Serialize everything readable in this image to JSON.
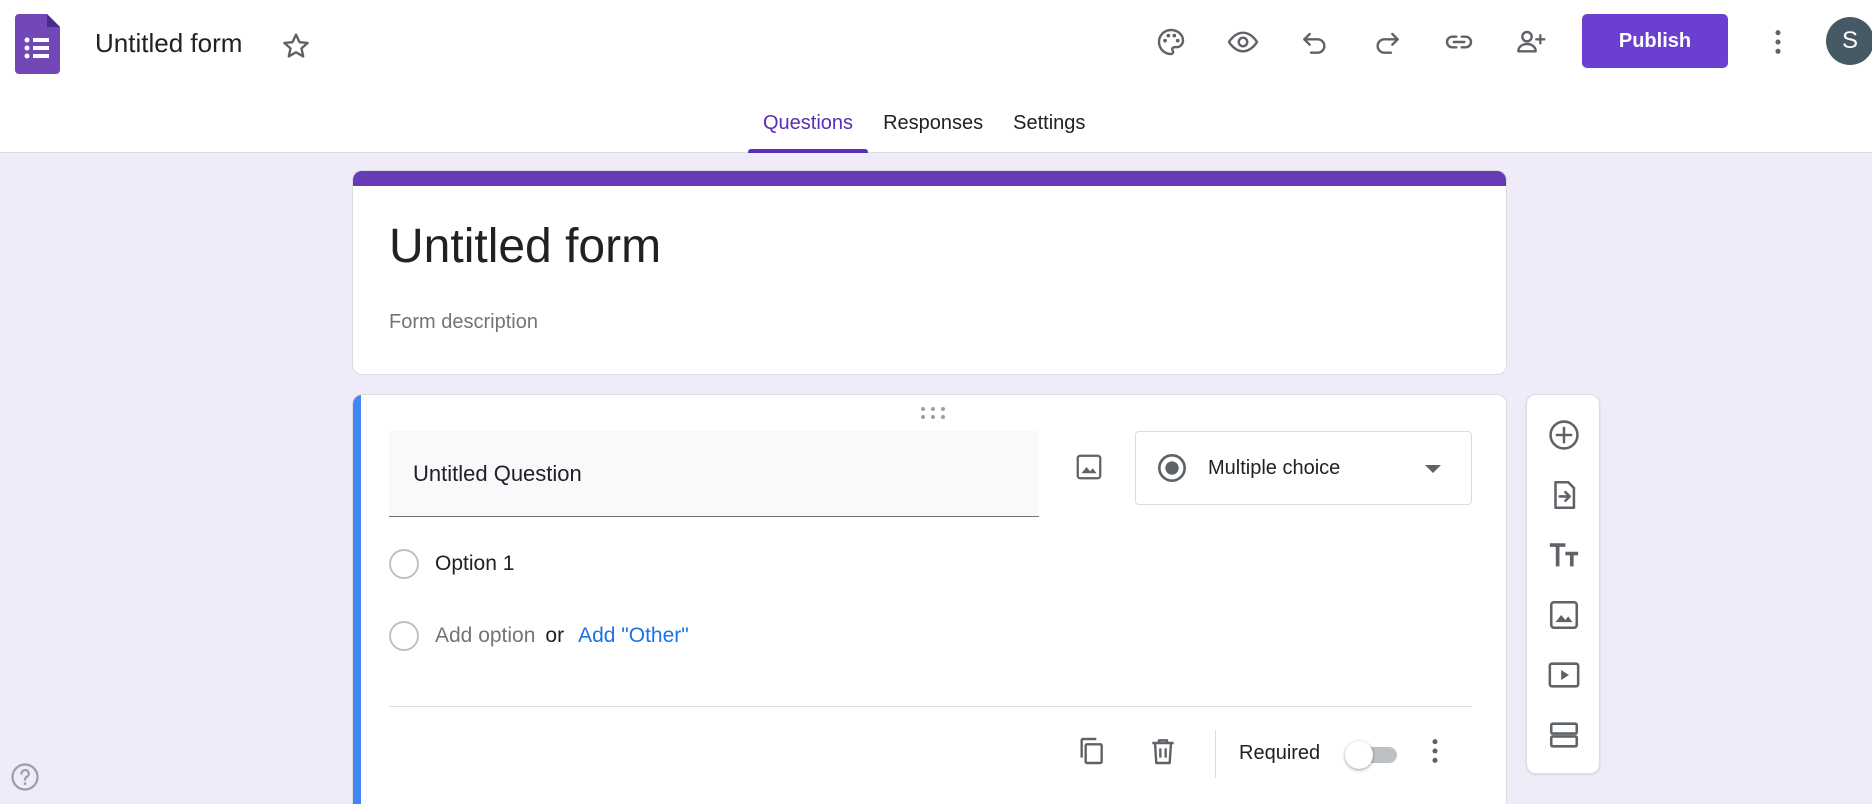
{
  "header": {
    "doc_title": "Untitled form",
    "publish_label": "Publish",
    "avatar_initial": "S",
    "toolbar_icons": [
      "palette-icon",
      "preview-eye-icon",
      "undo-icon",
      "redo-icon",
      "link-icon",
      "add-collaborator-icon",
      "more-vert-icon"
    ]
  },
  "tabs": [
    {
      "label": "Questions",
      "active": true
    },
    {
      "label": "Responses",
      "active": false
    },
    {
      "label": "Settings",
      "active": false
    }
  ],
  "form": {
    "title": "Untitled form",
    "description_placeholder": "Form description"
  },
  "question": {
    "title": "Untitled Question",
    "type": "Multiple choice",
    "options": [
      "Option 1"
    ],
    "add_option": "Add option",
    "or": "or",
    "add_other": "Add \"Other\"",
    "required_label": "Required",
    "required": false
  },
  "side_toolbar": [
    "add-question-icon",
    "import-questions-icon",
    "add-title-icon",
    "add-image-icon",
    "add-video-icon",
    "add-section-icon"
  ],
  "colors": {
    "accent": "#673ab7",
    "publish": "#6b3fcf",
    "background": "#f0ebf8",
    "active_card": "#4285f4",
    "link": "#1a73e8"
  }
}
